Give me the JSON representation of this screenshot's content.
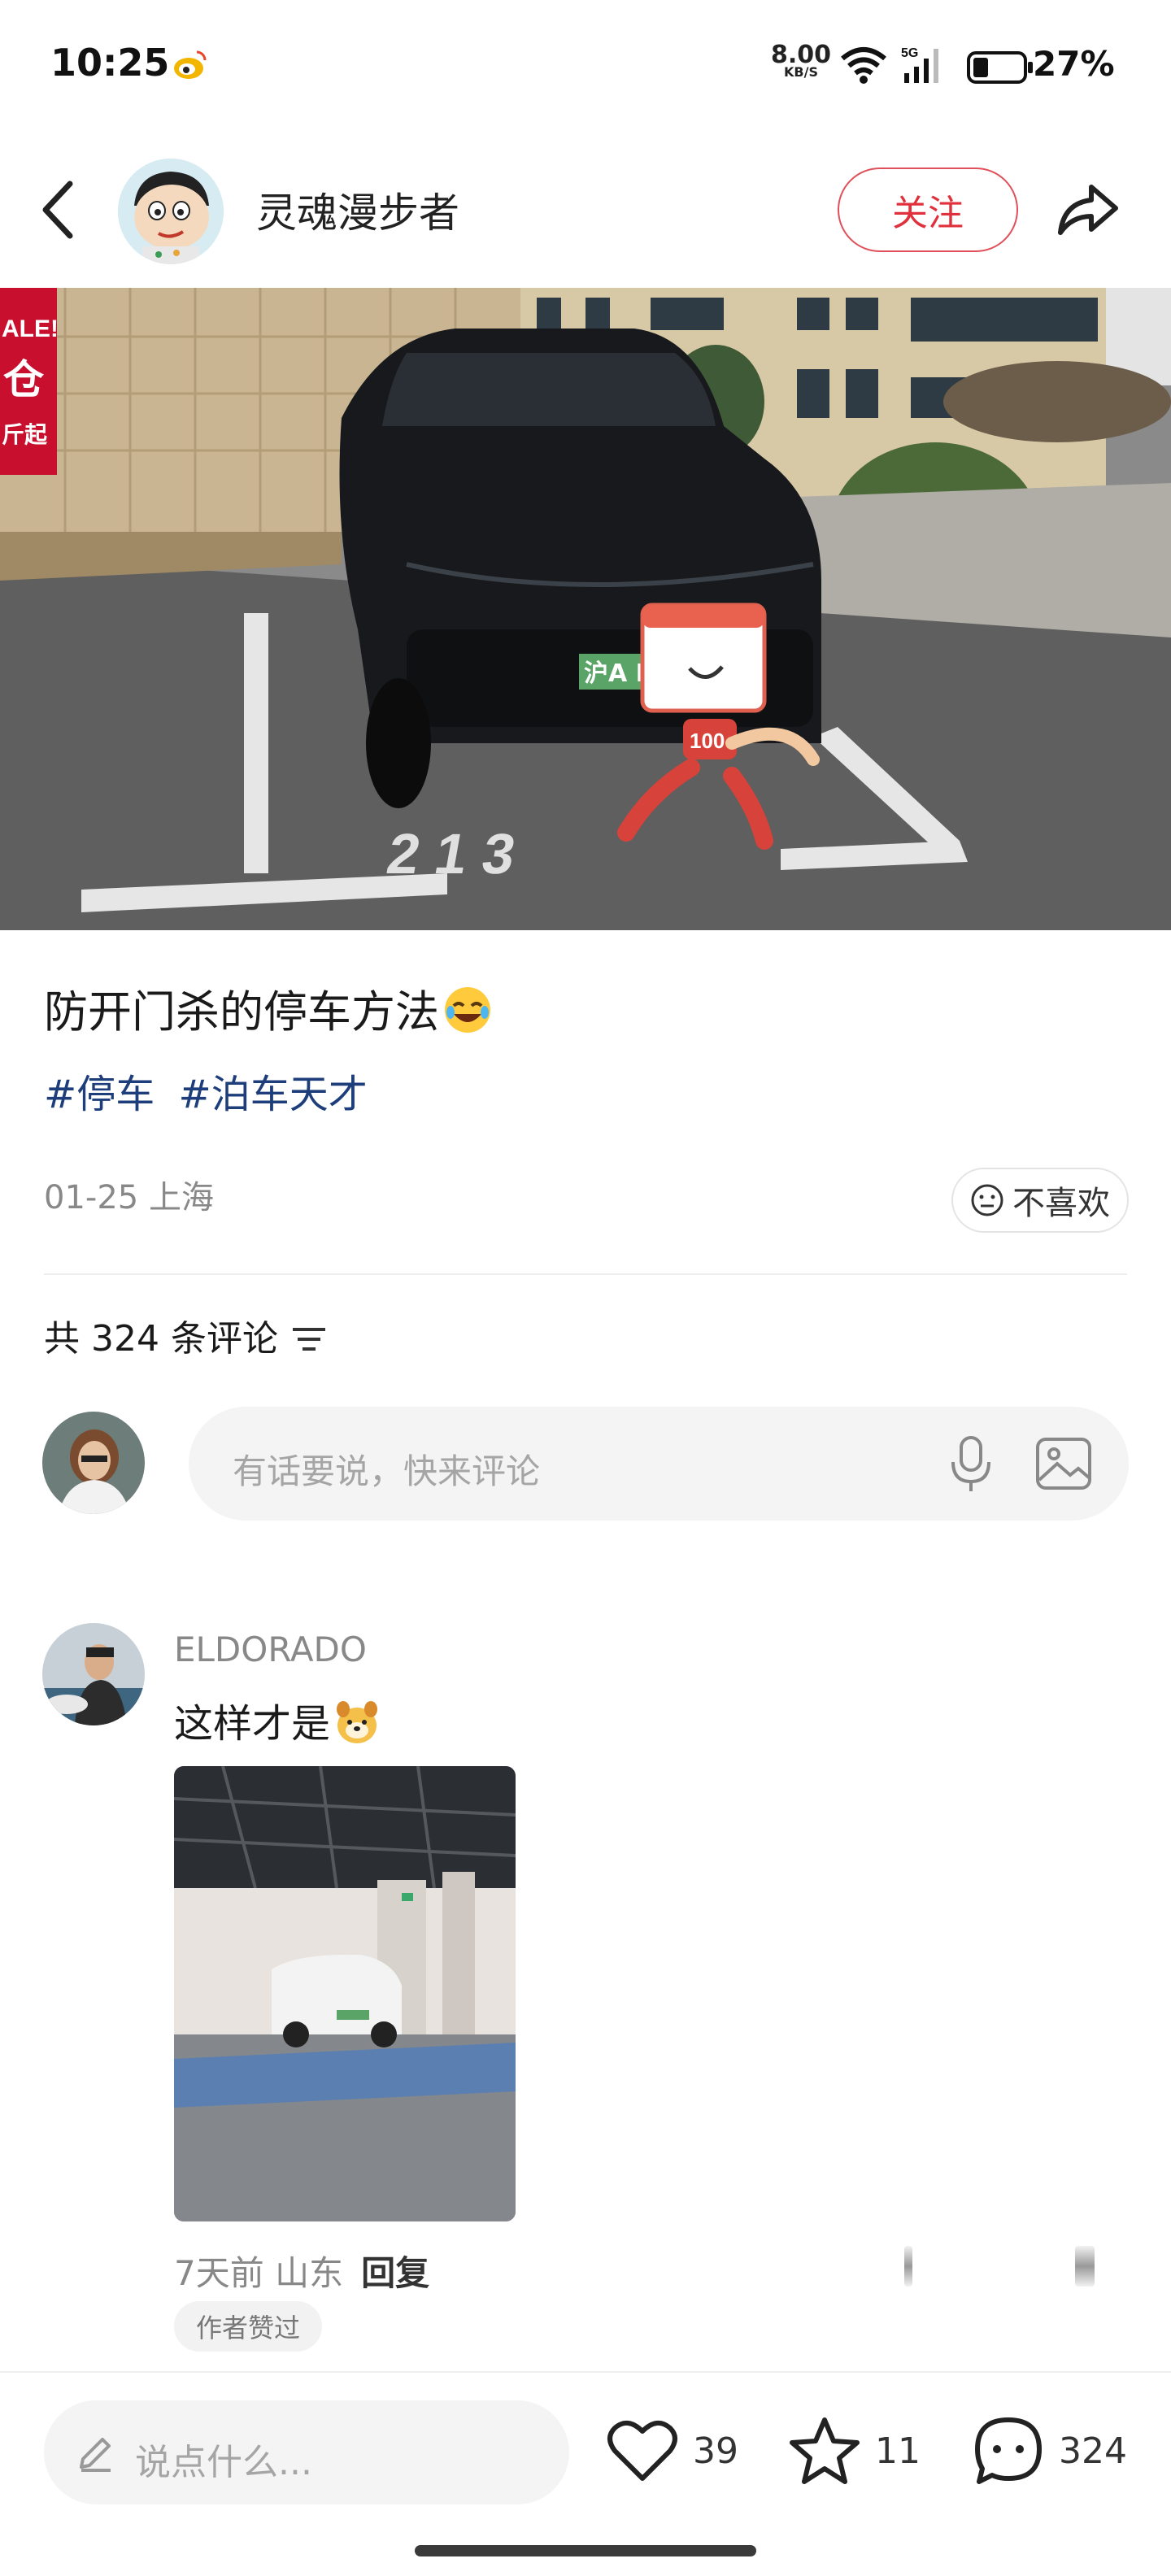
{
  "status_bar": {
    "time": "10:25",
    "net_speed_value": "8.00",
    "net_speed_unit": "KB/S",
    "network": "5G",
    "battery": "27%"
  },
  "header": {
    "author_name": "灵魂漫步者",
    "follow_label": "关注"
  },
  "post": {
    "title": "防开门杀的停车方法",
    "tags": [
      "#停车",
      "#泊车天才"
    ],
    "meta": "01-25 上海",
    "dislike_label": "不喜欢",
    "hero_plate": "沪A B",
    "hero_space_number": "2 1 3",
    "hero_sticker_number": "100",
    "hero_banner": [
      "ALE!",
      "仓",
      "斤起"
    ]
  },
  "comments": {
    "count_label": "共 324 条评论",
    "input_placeholder": "有话要说，快来评论",
    "items": [
      {
        "name": "ELDORADO",
        "text": "这样才是",
        "meta": "7天前 山东",
        "reply_label": "回复",
        "badge": "作者赞过"
      }
    ]
  },
  "bottom_bar": {
    "placeholder": "说点什么...",
    "likes": "39",
    "favorites": "11",
    "comments": "324"
  },
  "colors": {
    "accent_red": "#e0303c",
    "tag_blue": "#1d3e7a"
  }
}
